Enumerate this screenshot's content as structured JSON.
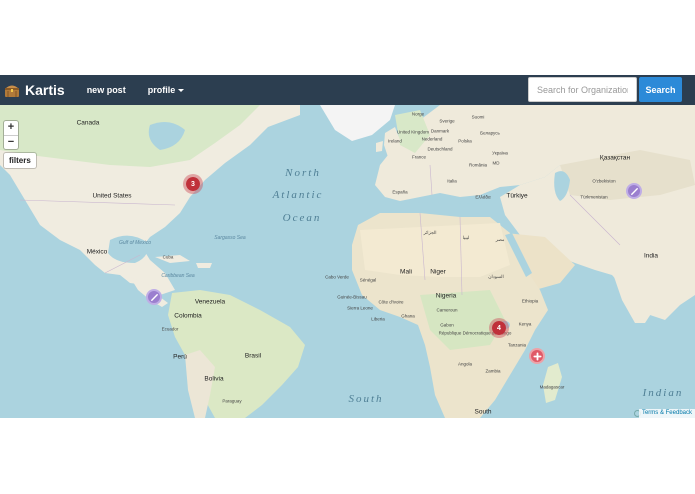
{
  "app": {
    "name": "Kartis"
  },
  "nav": {
    "links": [
      {
        "label": "new post"
      },
      {
        "label": "profile"
      }
    ]
  },
  "search": {
    "placeholder": "Search for Organizations",
    "button_label": "Search"
  },
  "map_controls": {
    "zoom_in": "+",
    "zoom_out": "−",
    "filters_label": "filters",
    "attribution": "Terms & Feedback"
  },
  "markers": {
    "cluster_us": "3",
    "cluster_africa": "4"
  },
  "map_labels": {
    "canada": "Canada",
    "united_states": "United States",
    "mexico": "México",
    "cuba": "Cuba",
    "venezuela": "Venezuela",
    "colombia": "Colombia",
    "ecuador": "Ecuador",
    "peru": "Perú",
    "brasil": "Brasil",
    "bolivia": "Bolivia",
    "paraguay": "Paraguay",
    "gulf_of_mexico": "Gulf of Mexico",
    "sargasso_sea": "Sargasso Sea",
    "caribbean_sea": "Caribbean Sea",
    "ocean_north": "North",
    "ocean_atlantic": "Atlantic",
    "ocean_ocean": "Ocean",
    "ocean_south": "South",
    "ocean_indian": "Indian",
    "deutschland": "Deutschland",
    "france": "France",
    "espana": "España",
    "polska": "Polska",
    "ukraine": "Україна",
    "turkiye": "Türkiye",
    "kazakhstan": "Қазақстан",
    "uzbekistan": "O'zbekiston",
    "turkmenistan": "Türkmenistan",
    "india": "India",
    "mali": "Mali",
    "niger": "Niger",
    "nigeria": "Nigeria",
    "ethiopia": "Ethiopia",
    "kenya": "Kenya",
    "tanzania": "Tanzania",
    "angola": "Angola",
    "zambia": "Zambia",
    "south": "South",
    "madagascar": "Madagascar",
    "cabo_verde": "Cabo Verde",
    "senegal": "Sénégal",
    "guinee": "Guinée-Bissau",
    "sierra_leone": "Sierra Leone",
    "liberia": "Liberia",
    "cote_divoire": "Côte d'Ivoire",
    "ghana": "Ghana",
    "cameroon": "Cameroun",
    "gabon": "Gabon",
    "rdc": "République Démocratique du Congo",
    "algeria": "الجزائر",
    "egypt": "مصر",
    "libya": "ليبيا",
    "sudan": "السودان",
    "sweden": "Sverige",
    "finland": "Suomi",
    "norway": "Norge",
    "danmark": "Danmark",
    "belarus": "Беларусь",
    "greece": "Ελλάδα",
    "italia": "Italia",
    "romania": "România",
    "moldova": "MD",
    "nederland": "Nederland",
    "ireland": "Ireland",
    "uk": "United Kingdom"
  },
  "colors": {
    "navbar": "#2c3e50",
    "search_button": "#2c8ad8",
    "water": "#abd3df",
    "land": "#f2efe9",
    "cluster": "#c0303a",
    "pin_purple": "#9b7fcf",
    "pin_red": "#e05a67"
  },
  "icons": {
    "brand": "treasure-chest-icon",
    "purple_pin": "pencil-icon",
    "red_pin": "medical-cross-icon"
  }
}
